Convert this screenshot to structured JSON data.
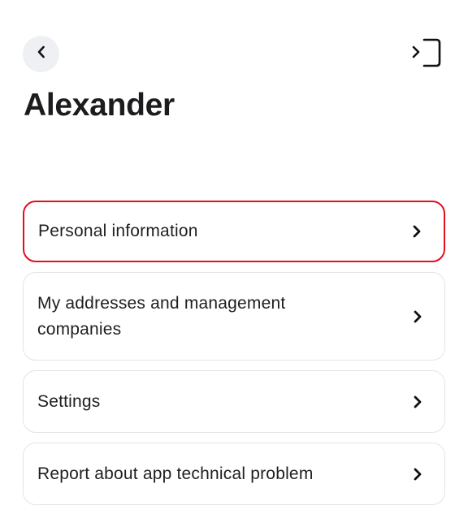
{
  "header": {
    "back_icon": "chevron-left-icon",
    "logout_icon": "logout-icon",
    "title": "Alexander"
  },
  "menu": {
    "items": [
      {
        "label": "Personal information",
        "selected": true
      },
      {
        "label": "My addresses and management companies",
        "selected": false
      },
      {
        "label": "Settings",
        "selected": false
      },
      {
        "label": "Report about app technical problem",
        "selected": false
      }
    ],
    "chevron_icon": "chevron-right-icon"
  },
  "colors": {
    "highlight_border": "#e0101c",
    "card_border": "#e3e4e8",
    "back_button_bg": "#eff0f3"
  }
}
